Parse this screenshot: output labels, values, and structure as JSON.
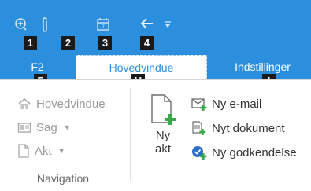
{
  "keytips": {
    "qa1": "1",
    "qa2": "2",
    "qa3": "3",
    "qa4": "4",
    "f2": "F",
    "hovedvindue": "H",
    "indstillinger": "I"
  },
  "tabs": {
    "f2": "F2",
    "hovedvindue": "Hovedvindue",
    "indstillinger": "Indstillinger"
  },
  "navigation": {
    "items": [
      "Hovedvindue",
      "Sag",
      "Akt"
    ],
    "group_label": "Navigation"
  },
  "new": {
    "big_button": {
      "line1": "Ny",
      "line2": "akt"
    },
    "items": [
      "Ny e-mail",
      "Nyt dokument",
      "Ny godkendelse"
    ]
  },
  "colors": {
    "accent": "#2b8fde",
    "keytip_bg": "#1a1a1a",
    "disabled_text": "#9a9a9a",
    "green": "#3aa84a"
  },
  "icons": [
    "add-circle-icon",
    "paperclip-icon",
    "calendar-icon",
    "back-arrow-icon",
    "dropdown-arrow-icon",
    "home-icon",
    "case-icon",
    "document-icon",
    "new-document-icon",
    "new-email-icon",
    "new-document-small-icon",
    "approval-icon"
  ]
}
